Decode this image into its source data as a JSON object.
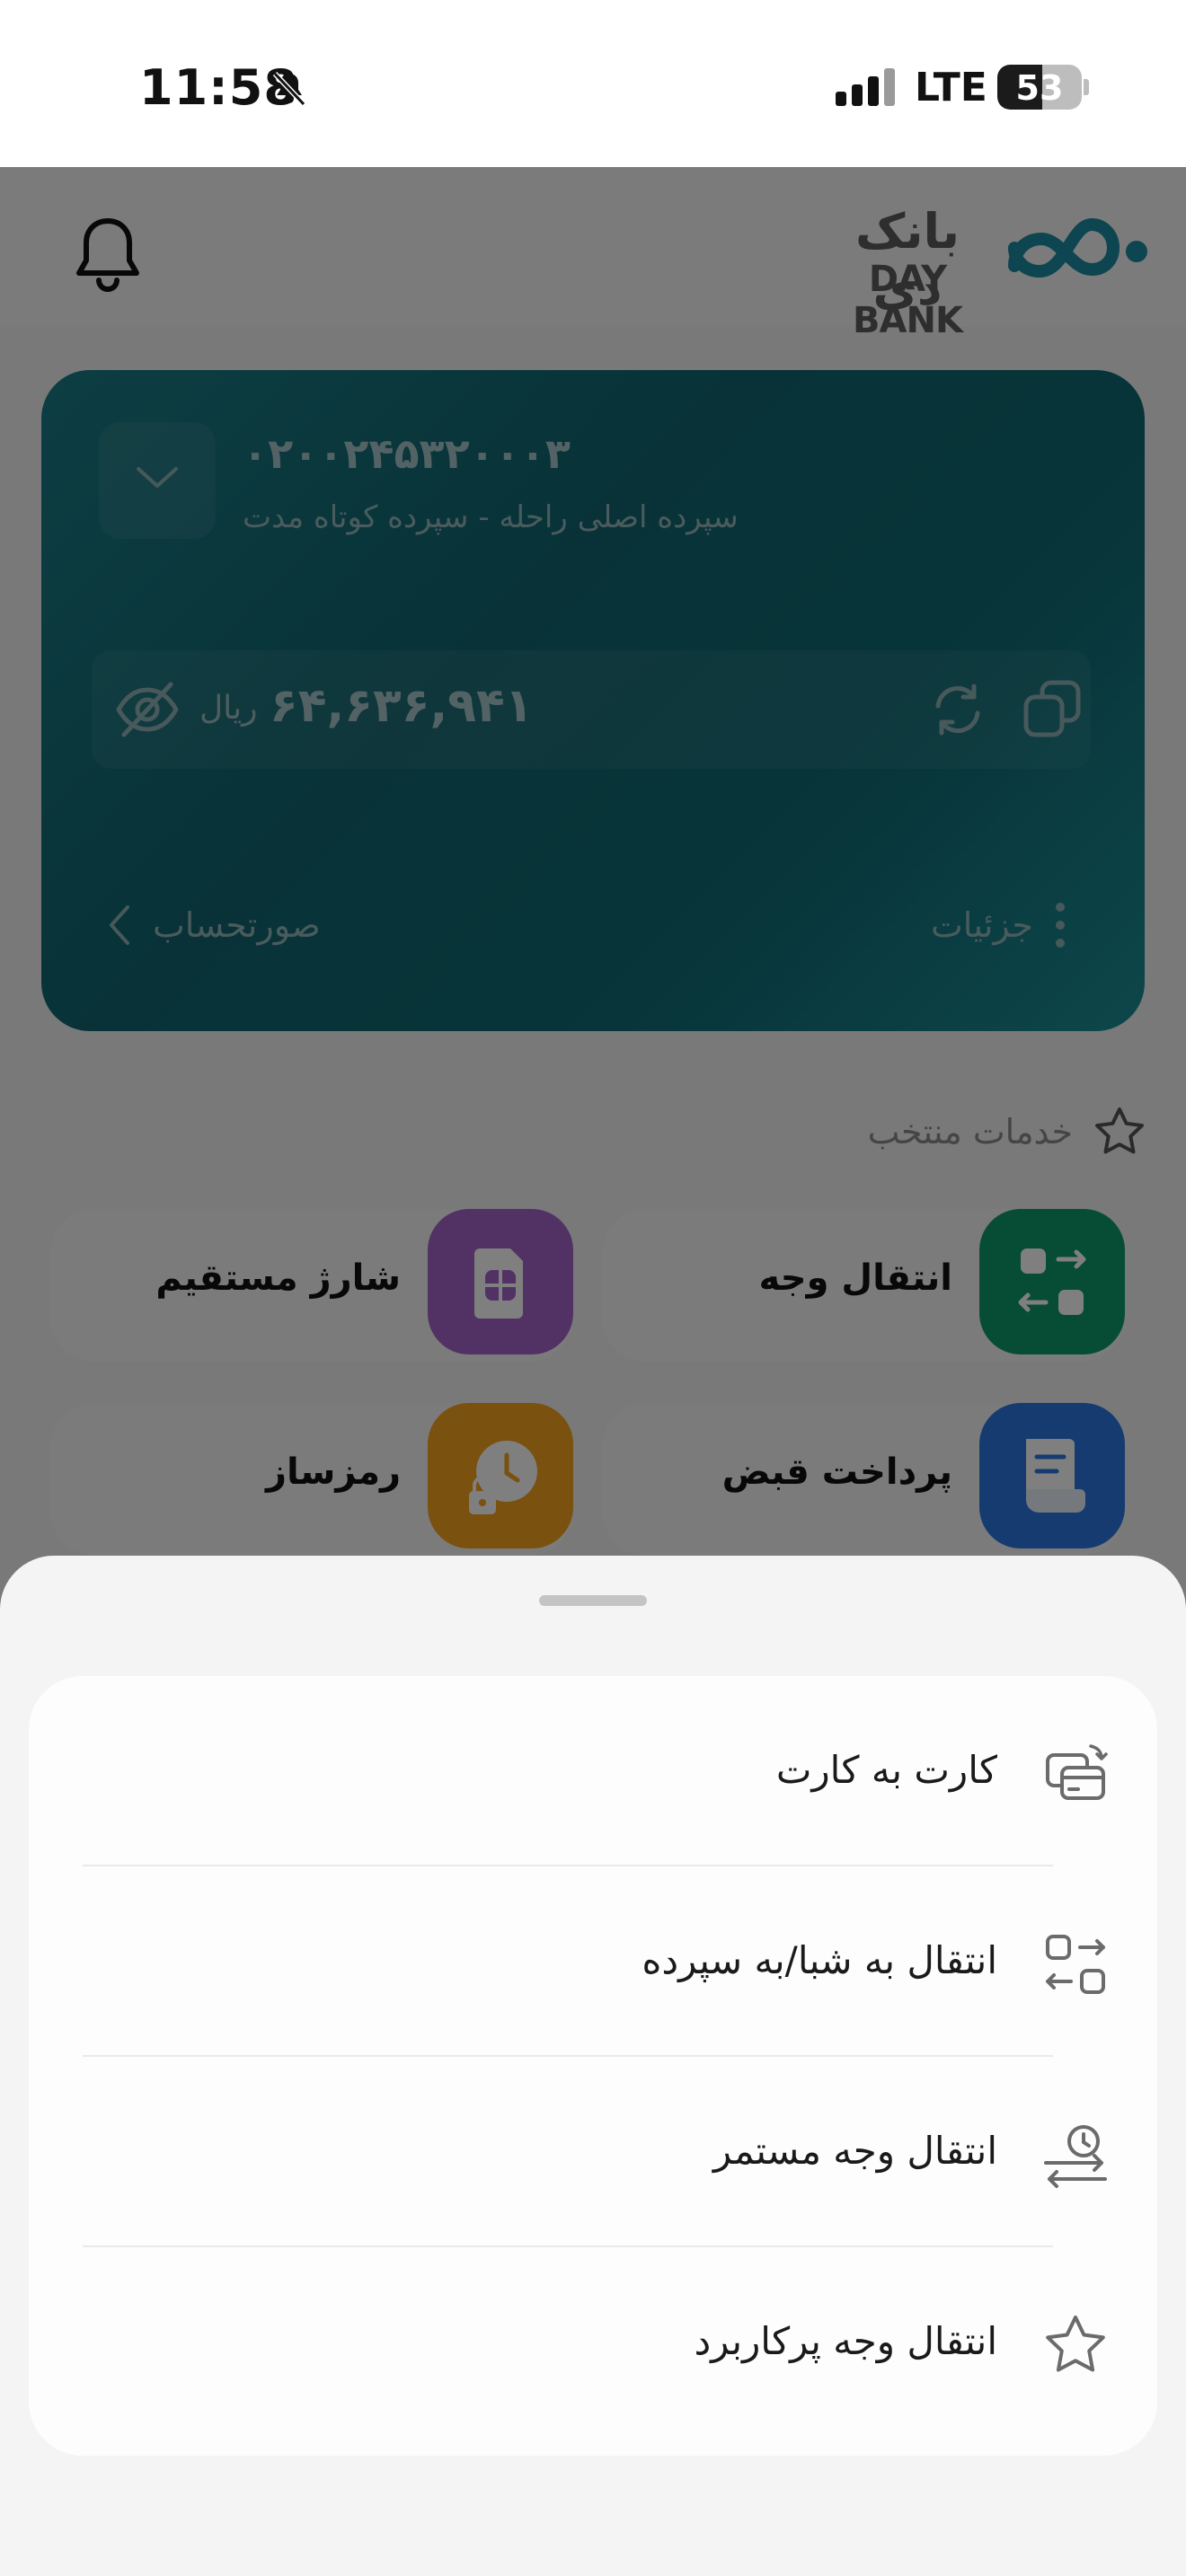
{
  "status_bar": {
    "time": "11:58",
    "network": "LTE",
    "battery": "53",
    "battery_level": 0.53
  },
  "header": {
    "logo_fa": "بانک دی",
    "logo_en": "DAY BANK"
  },
  "account_card": {
    "account_number": "۰۲۰۰۲۴۵۳۲۰۰۰۳",
    "account_description": "سپرده اصلی راحله - سپرده کوتاه مدت",
    "balance": "۶۴,۶۳۶,۹۴۱",
    "currency": "ریال",
    "statement_label": "صورتحساب",
    "details_label": "جزئیات"
  },
  "services": {
    "title": "خدمات منتخب",
    "items": [
      {
        "label": "انتقال وجه",
        "color": "#0e9b6b"
      },
      {
        "label": "شارژ مستقیم",
        "color": "#a564c9"
      },
      {
        "label": "پرداخت قبض",
        "color": "#2b77e0"
      },
      {
        "label": "رمزساز",
        "color": "#f4a21c"
      }
    ]
  },
  "sheet": {
    "items": [
      {
        "label": "کارت به کارت",
        "icon": "card-transfer-icon"
      },
      {
        "label": "انتقال به شبا/به سپرده",
        "icon": "transfer-arrows-icon"
      },
      {
        "label": "انتقال وجه مستمر",
        "icon": "scheduled-transfer-icon"
      },
      {
        "label": "انتقال وجه پرکاربرد",
        "icon": "star-icon"
      }
    ]
  },
  "colors": {
    "card": "#10656f",
    "overlay": "rgba(0,0,0,0.5)",
    "sheet_bg": "#f4f4f4"
  }
}
